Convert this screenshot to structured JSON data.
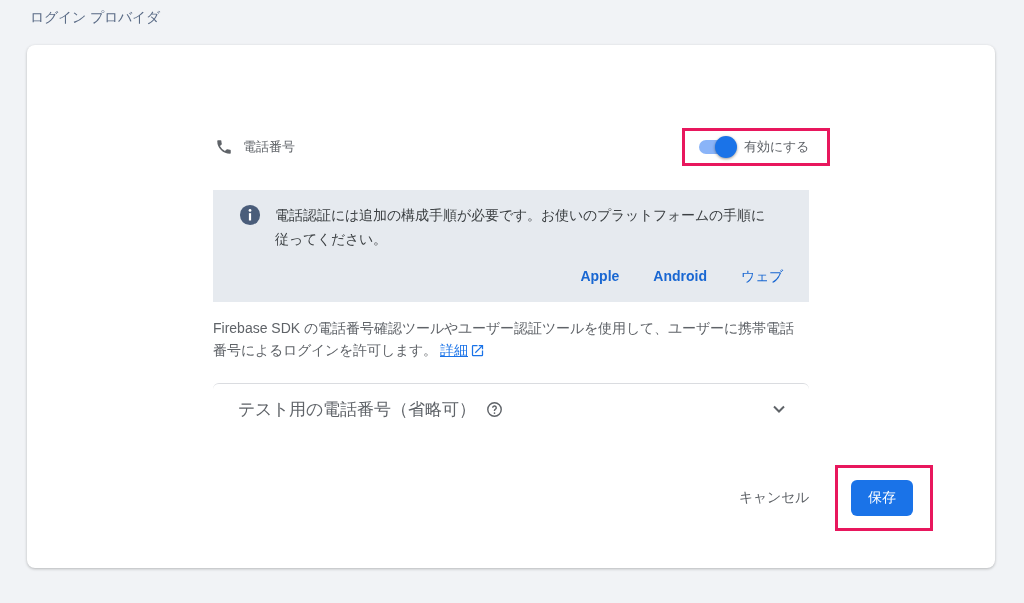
{
  "page_title": "ログイン プロバイダ",
  "provider": {
    "name": "電話番号",
    "toggle": {
      "label": "有効にする",
      "on": true,
      "highlighted": true
    }
  },
  "notice": {
    "text": "電話認証には追加の構成手順が必要です。お使いのプラットフォームの手順に従ってください。",
    "links": [
      "Apple",
      "Android",
      "ウェブ"
    ]
  },
  "description": {
    "text": "Firebase SDK の電話番号確認ツールやユーザー認証ツールを使用して、ユーザーに携帯電話番号によるログインを許可します。",
    "link": "詳細"
  },
  "test_numbers": {
    "title": "テスト用の電話番号（省略可）",
    "expanded": false
  },
  "buttons": {
    "cancel": "キャンセル",
    "save": {
      "label": "保存",
      "highlighted": true
    }
  }
}
